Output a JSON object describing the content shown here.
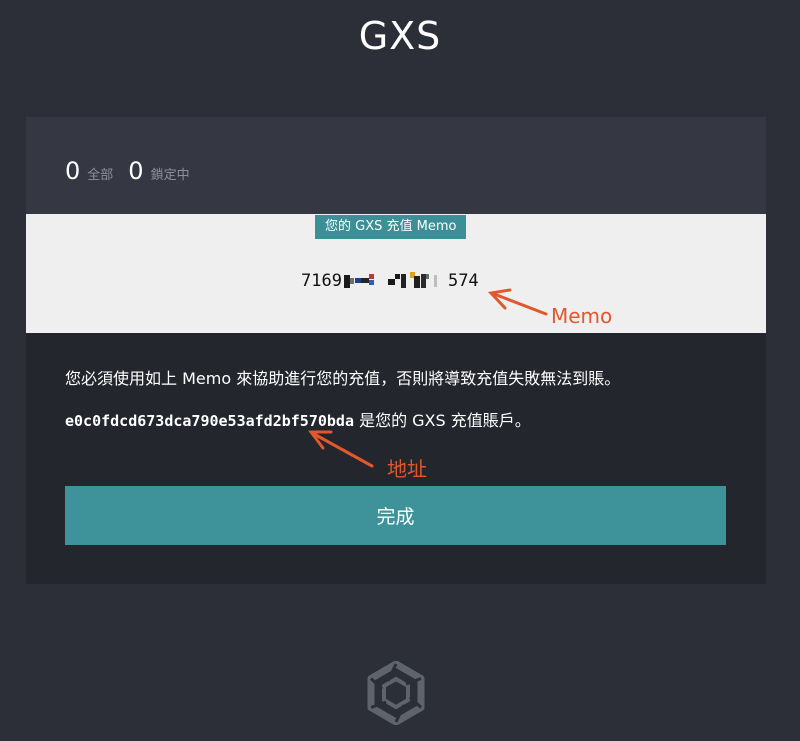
{
  "header": {
    "title": "GXS"
  },
  "balances": [
    {
      "value": "0",
      "label": "全部"
    },
    {
      "value": "0",
      "label": "鎖定中"
    }
  ],
  "memo": {
    "tag": "您的 GXS 充值 Memo",
    "prefix": "7169",
    "suffix": "574"
  },
  "instructions": {
    "notice": "您必須使用如上 Memo 來協助進行您的充值，否則將導致充值失敗無法到賬。",
    "address": "e0c0fdcd673dca790e53afd2bf570bda",
    "address_suffix": " 是您的 GXS 充值賬戶。"
  },
  "actions": {
    "done_label": "完成"
  },
  "annotations": {
    "memo_label": "Memo",
    "address_label": "地址",
    "color": "#e0582b"
  },
  "icons": {
    "logo": "gxs-logo-icon"
  }
}
